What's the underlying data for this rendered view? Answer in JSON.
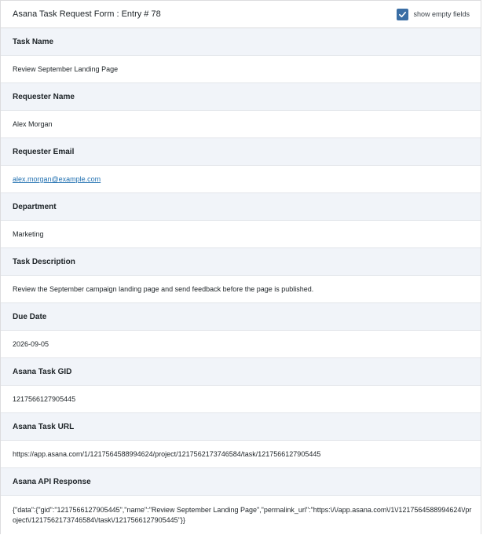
{
  "header": {
    "title": "Asana Task Request Form : Entry # 78",
    "toggle_label": "show empty fields",
    "toggle_checked": true,
    "accent_color": "#3a6ea5"
  },
  "fields": [
    {
      "label": "Task Name",
      "value": "Review September Landing Page"
    },
    {
      "label": "Requester Name",
      "value": "Alex Morgan"
    },
    {
      "label": "Requester Email",
      "value": "alex.morgan@example.com"
    },
    {
      "label": "Department",
      "value": "Marketing"
    },
    {
      "label": "Task Description",
      "value": "Review the September campaign landing page and send feedback before the page is published."
    },
    {
      "label": "Due Date",
      "value": "2026-09-05"
    },
    {
      "label": "Asana Task GID",
      "value": "1217566127905445"
    },
    {
      "label": "Asana Task URL",
      "value": "https://app.asana.com/1/1217564588994624/project/1217562173746584/task/1217566127905445"
    },
    {
      "label": "Asana API Response",
      "value": "{\"data\":{\"gid\":\"1217566127905445\",\"name\":\"Review September Landing Page\",\"permalink_url\":\"https:\\/\\/app.asana.com\\/1\\/1217564588994624\\/project\\/1217562173746584\\/task\\/1217566127905445\"}}"
    }
  ]
}
